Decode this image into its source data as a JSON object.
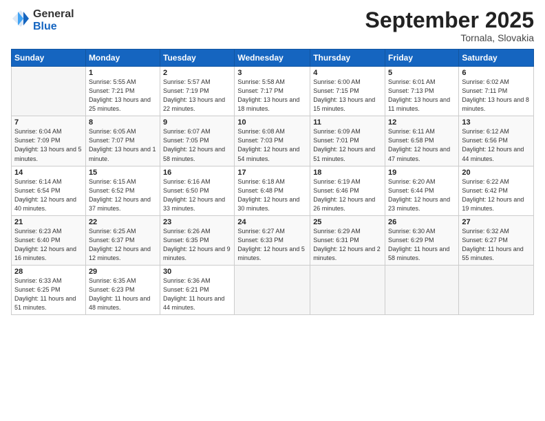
{
  "logo": {
    "line1": "General",
    "line2": "Blue"
  },
  "header": {
    "month": "September 2025",
    "location": "Tornala, Slovakia"
  },
  "weekdays": [
    "Sunday",
    "Monday",
    "Tuesday",
    "Wednesday",
    "Thursday",
    "Friday",
    "Saturday"
  ],
  "weeks": [
    [
      {
        "day": "",
        "sunrise": "",
        "sunset": "",
        "daylight": ""
      },
      {
        "day": "1",
        "sunrise": "Sunrise: 5:55 AM",
        "sunset": "Sunset: 7:21 PM",
        "daylight": "Daylight: 13 hours and 25 minutes."
      },
      {
        "day": "2",
        "sunrise": "Sunrise: 5:57 AM",
        "sunset": "Sunset: 7:19 PM",
        "daylight": "Daylight: 13 hours and 22 minutes."
      },
      {
        "day": "3",
        "sunrise": "Sunrise: 5:58 AM",
        "sunset": "Sunset: 7:17 PM",
        "daylight": "Daylight: 13 hours and 18 minutes."
      },
      {
        "day": "4",
        "sunrise": "Sunrise: 6:00 AM",
        "sunset": "Sunset: 7:15 PM",
        "daylight": "Daylight: 13 hours and 15 minutes."
      },
      {
        "day": "5",
        "sunrise": "Sunrise: 6:01 AM",
        "sunset": "Sunset: 7:13 PM",
        "daylight": "Daylight: 13 hours and 11 minutes."
      },
      {
        "day": "6",
        "sunrise": "Sunrise: 6:02 AM",
        "sunset": "Sunset: 7:11 PM",
        "daylight": "Daylight: 13 hours and 8 minutes."
      }
    ],
    [
      {
        "day": "7",
        "sunrise": "Sunrise: 6:04 AM",
        "sunset": "Sunset: 7:09 PM",
        "daylight": "Daylight: 13 hours and 5 minutes."
      },
      {
        "day": "8",
        "sunrise": "Sunrise: 6:05 AM",
        "sunset": "Sunset: 7:07 PM",
        "daylight": "Daylight: 13 hours and 1 minute."
      },
      {
        "day": "9",
        "sunrise": "Sunrise: 6:07 AM",
        "sunset": "Sunset: 7:05 PM",
        "daylight": "Daylight: 12 hours and 58 minutes."
      },
      {
        "day": "10",
        "sunrise": "Sunrise: 6:08 AM",
        "sunset": "Sunset: 7:03 PM",
        "daylight": "Daylight: 12 hours and 54 minutes."
      },
      {
        "day": "11",
        "sunrise": "Sunrise: 6:09 AM",
        "sunset": "Sunset: 7:01 PM",
        "daylight": "Daylight: 12 hours and 51 minutes."
      },
      {
        "day": "12",
        "sunrise": "Sunrise: 6:11 AM",
        "sunset": "Sunset: 6:58 PM",
        "daylight": "Daylight: 12 hours and 47 minutes."
      },
      {
        "day": "13",
        "sunrise": "Sunrise: 6:12 AM",
        "sunset": "Sunset: 6:56 PM",
        "daylight": "Daylight: 12 hours and 44 minutes."
      }
    ],
    [
      {
        "day": "14",
        "sunrise": "Sunrise: 6:14 AM",
        "sunset": "Sunset: 6:54 PM",
        "daylight": "Daylight: 12 hours and 40 minutes."
      },
      {
        "day": "15",
        "sunrise": "Sunrise: 6:15 AM",
        "sunset": "Sunset: 6:52 PM",
        "daylight": "Daylight: 12 hours and 37 minutes."
      },
      {
        "day": "16",
        "sunrise": "Sunrise: 6:16 AM",
        "sunset": "Sunset: 6:50 PM",
        "daylight": "Daylight: 12 hours and 33 minutes."
      },
      {
        "day": "17",
        "sunrise": "Sunrise: 6:18 AM",
        "sunset": "Sunset: 6:48 PM",
        "daylight": "Daylight: 12 hours and 30 minutes."
      },
      {
        "day": "18",
        "sunrise": "Sunrise: 6:19 AM",
        "sunset": "Sunset: 6:46 PM",
        "daylight": "Daylight: 12 hours and 26 minutes."
      },
      {
        "day": "19",
        "sunrise": "Sunrise: 6:20 AM",
        "sunset": "Sunset: 6:44 PM",
        "daylight": "Daylight: 12 hours and 23 minutes."
      },
      {
        "day": "20",
        "sunrise": "Sunrise: 6:22 AM",
        "sunset": "Sunset: 6:42 PM",
        "daylight": "Daylight: 12 hours and 19 minutes."
      }
    ],
    [
      {
        "day": "21",
        "sunrise": "Sunrise: 6:23 AM",
        "sunset": "Sunset: 6:40 PM",
        "daylight": "Daylight: 12 hours and 16 minutes."
      },
      {
        "day": "22",
        "sunrise": "Sunrise: 6:25 AM",
        "sunset": "Sunset: 6:37 PM",
        "daylight": "Daylight: 12 hours and 12 minutes."
      },
      {
        "day": "23",
        "sunrise": "Sunrise: 6:26 AM",
        "sunset": "Sunset: 6:35 PM",
        "daylight": "Daylight: 12 hours and 9 minutes."
      },
      {
        "day": "24",
        "sunrise": "Sunrise: 6:27 AM",
        "sunset": "Sunset: 6:33 PM",
        "daylight": "Daylight: 12 hours and 5 minutes."
      },
      {
        "day": "25",
        "sunrise": "Sunrise: 6:29 AM",
        "sunset": "Sunset: 6:31 PM",
        "daylight": "Daylight: 12 hours and 2 minutes."
      },
      {
        "day": "26",
        "sunrise": "Sunrise: 6:30 AM",
        "sunset": "Sunset: 6:29 PM",
        "daylight": "Daylight: 11 hours and 58 minutes."
      },
      {
        "day": "27",
        "sunrise": "Sunrise: 6:32 AM",
        "sunset": "Sunset: 6:27 PM",
        "daylight": "Daylight: 11 hours and 55 minutes."
      }
    ],
    [
      {
        "day": "28",
        "sunrise": "Sunrise: 6:33 AM",
        "sunset": "Sunset: 6:25 PM",
        "daylight": "Daylight: 11 hours and 51 minutes."
      },
      {
        "day": "29",
        "sunrise": "Sunrise: 6:35 AM",
        "sunset": "Sunset: 6:23 PM",
        "daylight": "Daylight: 11 hours and 48 minutes."
      },
      {
        "day": "30",
        "sunrise": "Sunrise: 6:36 AM",
        "sunset": "Sunset: 6:21 PM",
        "daylight": "Daylight: 11 hours and 44 minutes."
      },
      {
        "day": "",
        "sunrise": "",
        "sunset": "",
        "daylight": ""
      },
      {
        "day": "",
        "sunrise": "",
        "sunset": "",
        "daylight": ""
      },
      {
        "day": "",
        "sunrise": "",
        "sunset": "",
        "daylight": ""
      },
      {
        "day": "",
        "sunrise": "",
        "sunset": "",
        "daylight": ""
      }
    ]
  ]
}
